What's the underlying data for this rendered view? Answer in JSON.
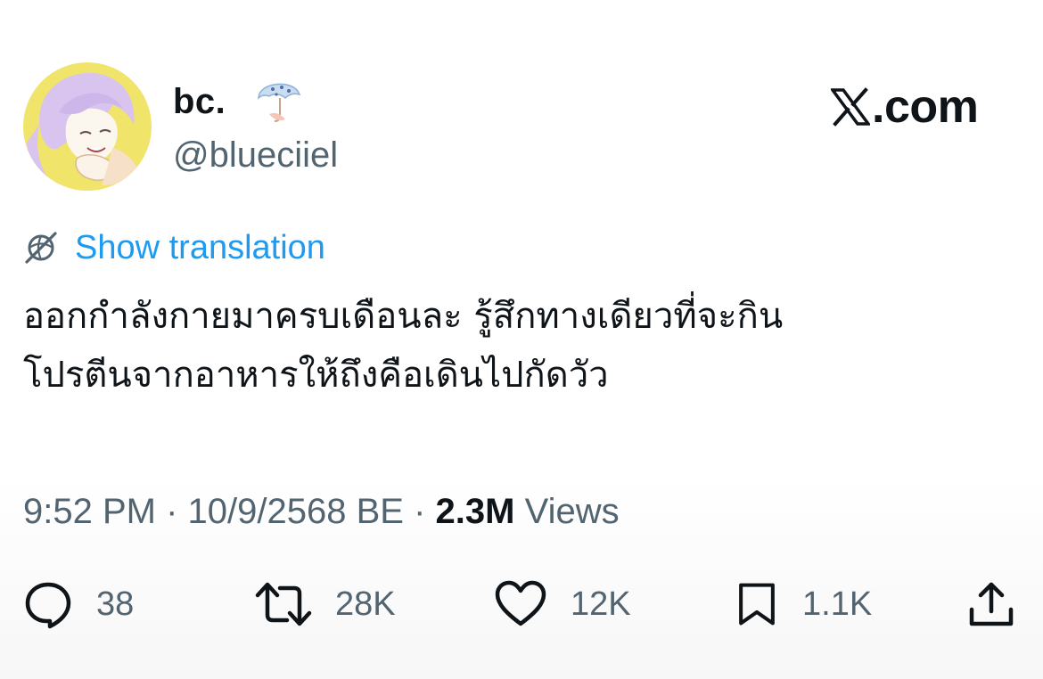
{
  "author": {
    "display_name": "bc.",
    "handle": "@blueciiel",
    "avatar": "avatar-illustration",
    "badge": "umbrella-badge-icon"
  },
  "site": {
    "label": ".com",
    "logo": "x-logo-icon"
  },
  "translation": {
    "icon": "globe-icon",
    "label": "Show translation",
    "color": "#1d9bf0"
  },
  "tweet": {
    "lines": [
      "ออกกำลังกายมาครบเดือนละ รู้สึกทางเดียวที่จะกิน",
      "โปรตีนจากอาหารให้ถึงคือเดินไปกัดวัว"
    ]
  },
  "meta": {
    "time": "9:52 PM",
    "separator": "·",
    "date": "10/9/2568 BE",
    "views_count": "2.3M",
    "views_label": "Views"
  },
  "actions": {
    "replies": {
      "icon": "reply-icon",
      "count": "38"
    },
    "reposts": {
      "icon": "repost-icon",
      "count": "28K"
    },
    "likes": {
      "icon": "heart-icon",
      "count": "12K"
    },
    "bookmarks": {
      "icon": "bookmark-icon",
      "count": "1.1K"
    },
    "share": {
      "icon": "share-icon"
    }
  },
  "colors": {
    "text": "#0f1419",
    "secondary": "#536471",
    "link": "#1d9bf0"
  }
}
